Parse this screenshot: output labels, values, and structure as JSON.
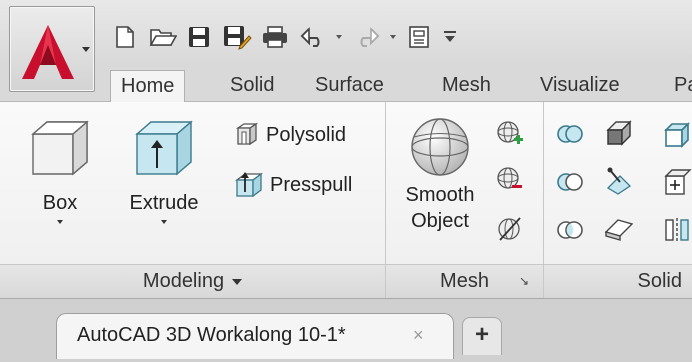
{
  "quick_access": {
    "items": [
      "new-icon",
      "open-icon",
      "save-icon",
      "save-as-icon",
      "plot-icon",
      "undo-icon",
      "redo-icon",
      "workspace-icon",
      "customize-icon"
    ]
  },
  "tabs": [
    {
      "label": "Home",
      "active": true
    },
    {
      "label": "Solid",
      "active": false
    },
    {
      "label": "Surface",
      "active": false
    },
    {
      "label": "Mesh",
      "active": false
    },
    {
      "label": "Visualize",
      "active": false
    },
    {
      "label": "Pa",
      "active": false
    }
  ],
  "modeling_panel": {
    "title": "Modeling",
    "box_label": "Box",
    "extrude_label": "Extrude",
    "polysolid_label": "Polysolid",
    "presspull_label": "Presspull"
  },
  "mesh_panel": {
    "title": "Mesh",
    "smooth_object_line1": "Smooth",
    "smooth_object_line2": "Object"
  },
  "solid_panel": {
    "title": "Solid"
  },
  "document": {
    "tab_title": "AutoCAD 3D Workalong 10-1*",
    "close_glyph": "×",
    "new_tab_glyph": "+"
  },
  "colors": {
    "logo_red": "#c8102e",
    "ribbon_bg": "#f3f3f3",
    "tab_bar_bg": "#d9d9d9"
  }
}
